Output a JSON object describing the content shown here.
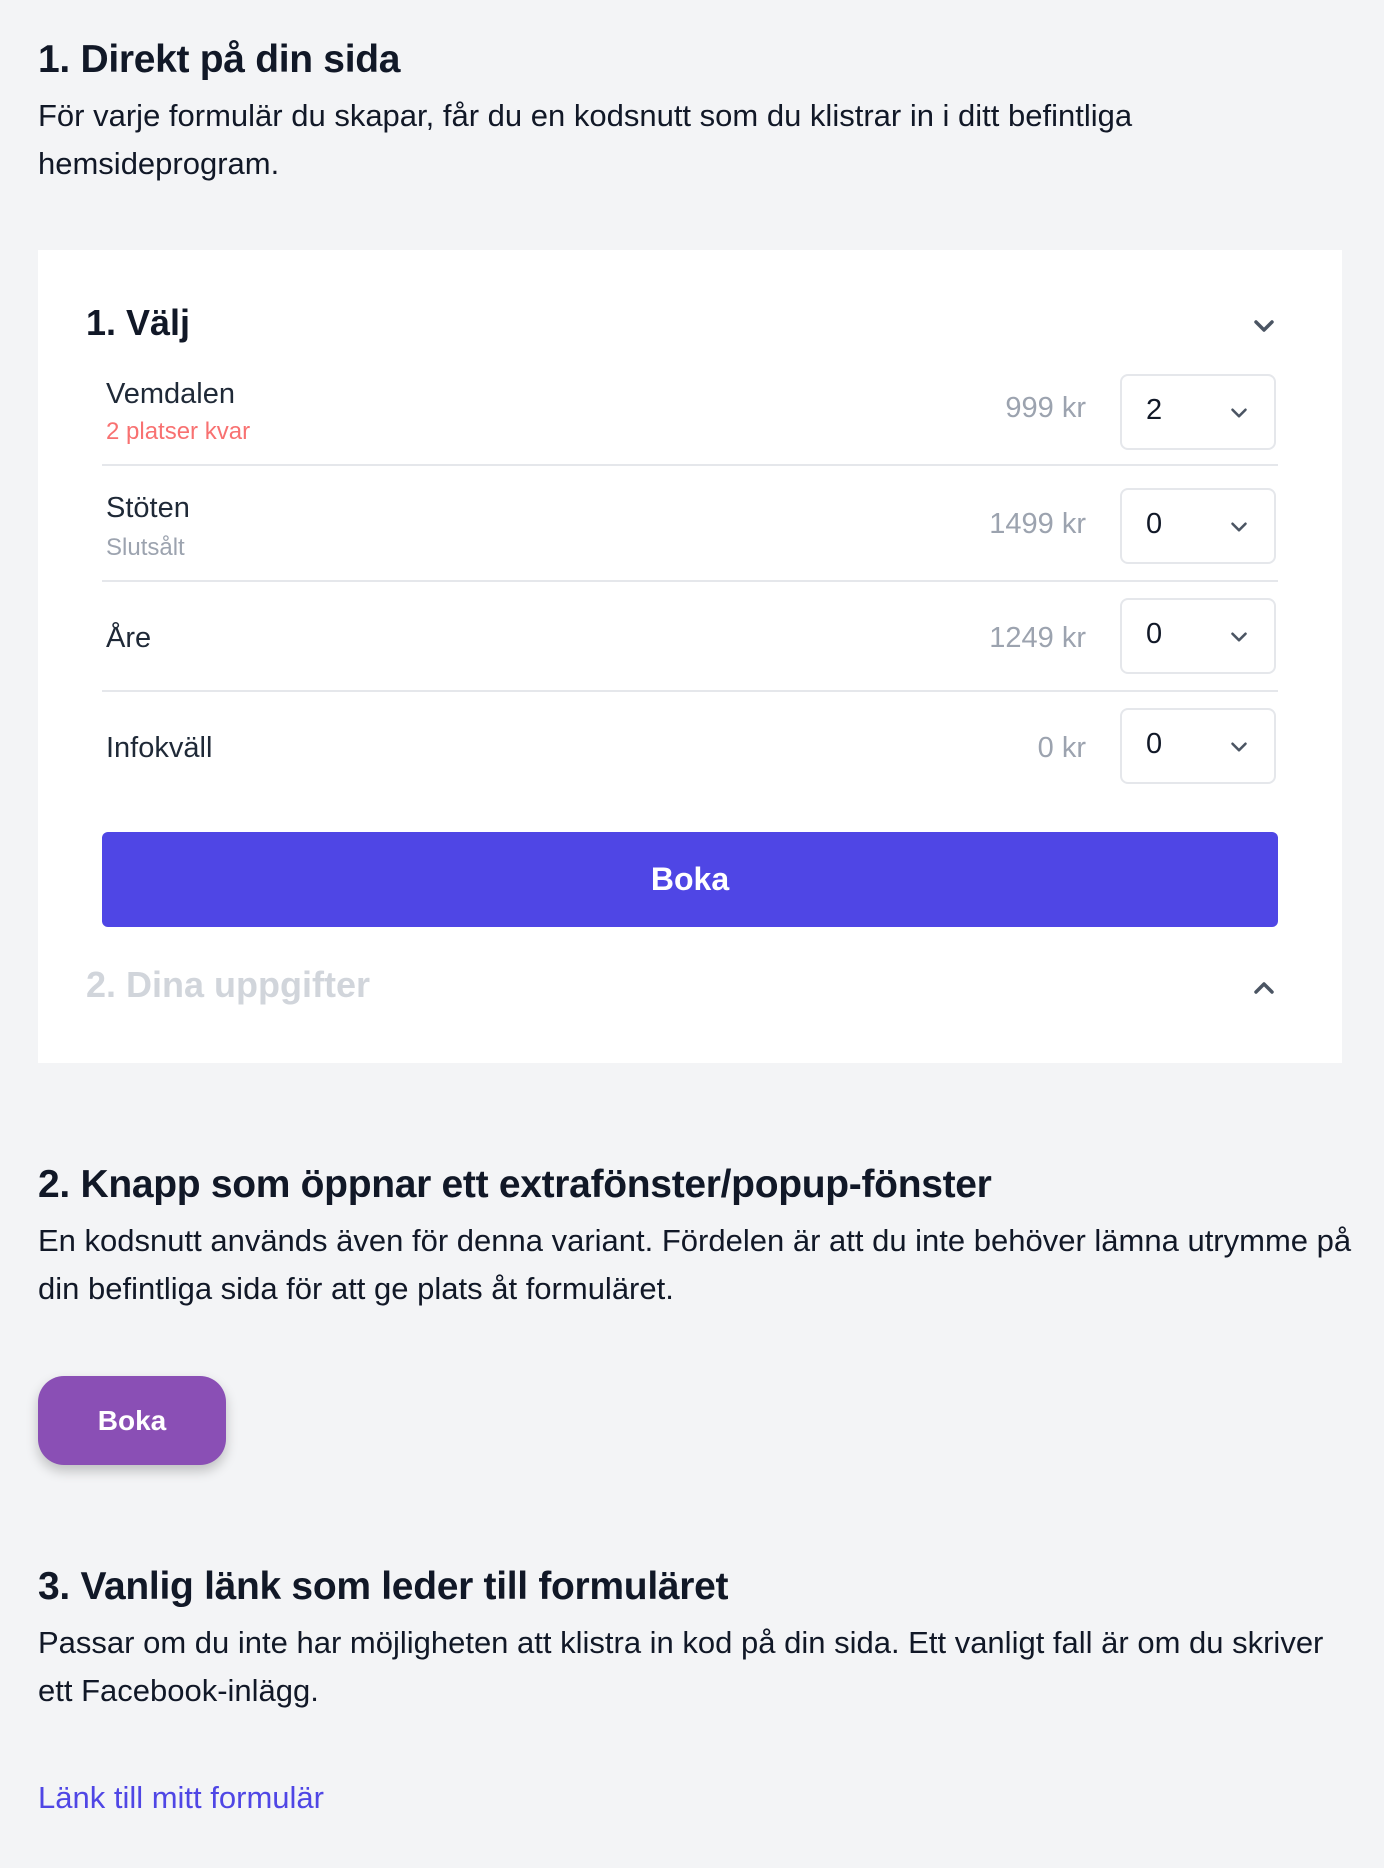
{
  "section1": {
    "title": "1. Direkt på din sida",
    "description": "För varje formulär du skapar, får du en kodsnutt som du klistrar in i ditt befintliga hemsideprogram."
  },
  "widget": {
    "step1_title": "1. Välj",
    "step2_title": "2. Dina uppgifter",
    "items": [
      {
        "name": "Vemdalen",
        "sub": "2 platser kvar",
        "price": "999 kr",
        "qty": "2"
      },
      {
        "name": "Stöten",
        "sub": "Slutsålt",
        "price": "1499 kr",
        "qty": "0"
      },
      {
        "name": "Åre",
        "sub": "",
        "price": "1249 kr",
        "qty": "0"
      },
      {
        "name": "Infokväll",
        "sub": "",
        "price": "0 kr",
        "qty": "0"
      }
    ],
    "submit_label": "Boka",
    "colors": {
      "primary": "#4f46e5",
      "warning": "#f87171",
      "muted": "#9ca3af"
    }
  },
  "section2": {
    "title": "2. Knapp som öppnar ett extrafönster/popup-fönster",
    "description": "En kodsnutt används även för denna variant. Fördelen är att du inte behöver lämna utrymme på din befintliga sida för att ge plats åt formuläret.",
    "button_label": "Boka",
    "button_color": "#8a4fb5"
  },
  "section3": {
    "title": "3. Vanlig länk som leder till formuläret",
    "description": "Passar om du inte har möjligheten att klistra in kod på din sida. Ett vanligt fall är om du skriver ett Facebook-inlägg.",
    "link_label": "Länk till mitt formulär"
  },
  "icons": {
    "step1_toggle": "chevron-down-icon",
    "step2_toggle": "chevron-up-icon",
    "select": "chevron-down-icon"
  }
}
